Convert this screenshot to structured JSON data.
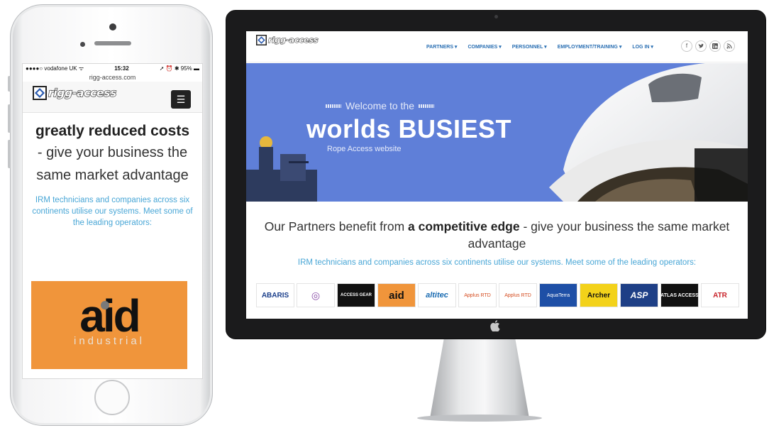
{
  "phone": {
    "status": {
      "carrier": "●●●●○ vodafone UK ᯤ",
      "time": "15:32",
      "battery": "➚ ⏰ ✱ 95% ▬"
    },
    "url": "rigg-access.com",
    "logo_text": "rigg-access",
    "menu_icon": "☰",
    "headline_bold": "greatly reduced costs",
    "headline_rest": "- give your business the same market advantage",
    "subtext": "IRM technicians and companies across six continents utilise our systems. Meet some of the leading operators:",
    "featured_logo": {
      "word": "aid",
      "subword": "industrial"
    }
  },
  "desktop": {
    "logo_text": "rigg-access",
    "nav": [
      "PARTNERS ▾",
      "COMPANIES ▾",
      "PERSONNEL ▾",
      "EMPLOYMENT/TRAINING ▾",
      "LOG IN ▾"
    ],
    "social": [
      "f",
      "t",
      "in",
      "rss"
    ],
    "hero": {
      "welcome": "Welcome to the",
      "title": "worlds BUSIEST",
      "subtitle": "Rope Access website"
    },
    "headline_pre": "Our Partners benefit from",
    "headline_bold": "a competitive edge",
    "headline_post": "- give your business the same market advantage",
    "subtext": "IRM technicians and companies across six continents utilise our systems. Meet some of the leading operators:",
    "partners": [
      {
        "label": "ABARIS",
        "bg": "#ffffff",
        "color": "#1b3f8b"
      },
      {
        "label": "◎",
        "bg": "#ffffff",
        "color": "#8a4fa8"
      },
      {
        "label": "ACCESS GEAR",
        "bg": "#111111",
        "color": "#ffffff"
      },
      {
        "label": "aid",
        "bg": "#f0953b",
        "color": "#111111"
      },
      {
        "label": "altitec",
        "bg": "#ffffff",
        "color": "#1b6cb2"
      },
      {
        "label": "Applus RTD",
        "bg": "#ffffff",
        "color": "#d44b1e"
      },
      {
        "label": "Applus RTD",
        "bg": "#ffffff",
        "color": "#d44b1e"
      },
      {
        "label": "AquaTerra",
        "bg": "#1e4fa6",
        "color": "#ffffff"
      },
      {
        "label": "Archer",
        "bg": "#f3d21a",
        "color": "#111111"
      },
      {
        "label": "ASP",
        "bg": "#1e3f86",
        "color": "#ffffff"
      },
      {
        "label": "ATLAS ACCESS",
        "bg": "#111111",
        "color": "#ffffff"
      },
      {
        "label": "ATR",
        "bg": "#ffffff",
        "color": "#c9242b"
      }
    ]
  },
  "monitor_logo": ""
}
